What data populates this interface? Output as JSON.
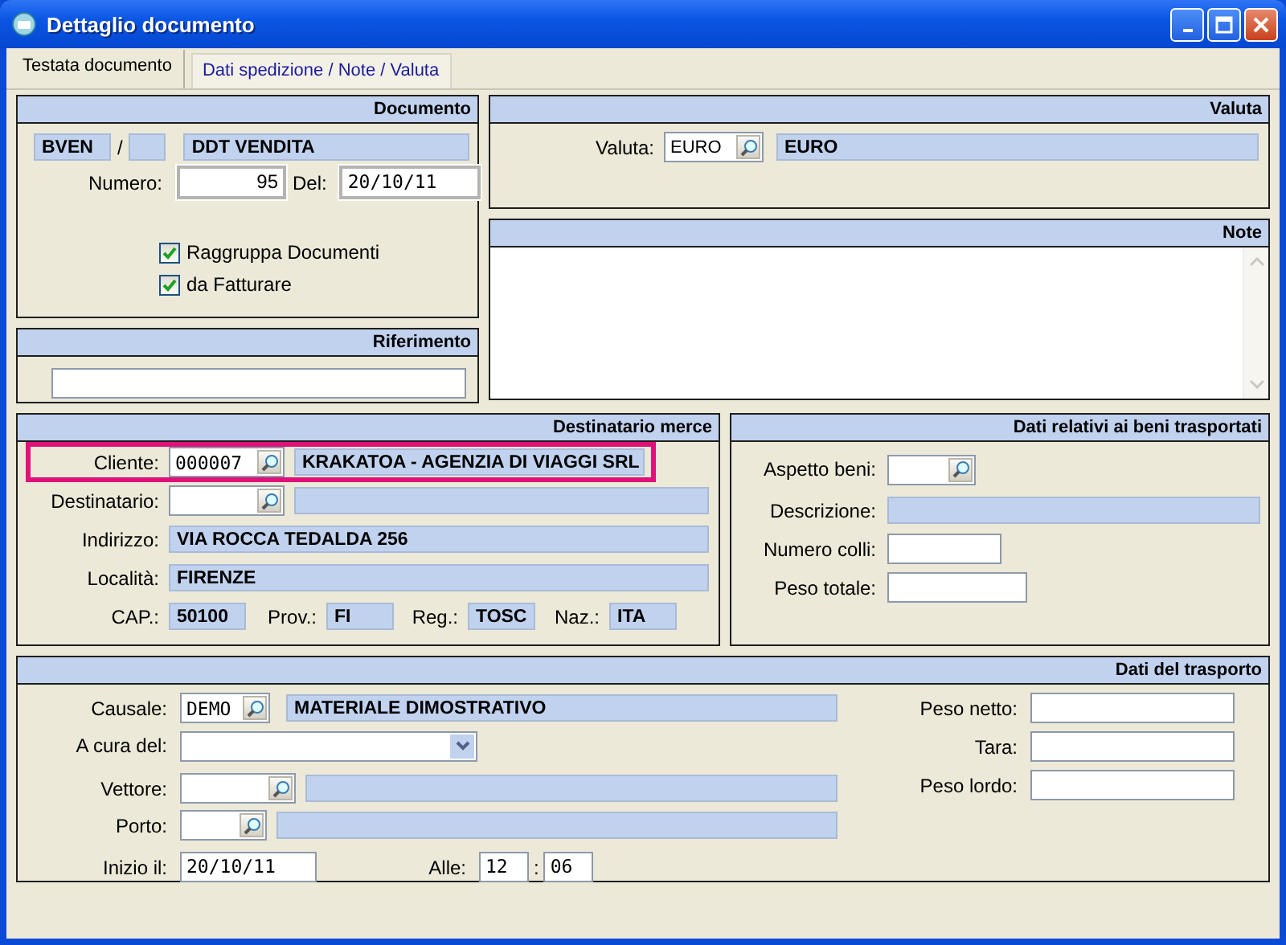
{
  "window": {
    "title": "Dettaglio documento"
  },
  "tabs": [
    {
      "label": "Testata documento",
      "selected": true
    },
    {
      "label": "Dati spedizione / Note / Valuta",
      "selected": false
    }
  ],
  "documento": {
    "title": "Documento",
    "serie": "BVEN",
    "separator": "/",
    "tipo": "DDT VENDITA",
    "numero_label": "Numero:",
    "numero": "95",
    "del_label": "Del:",
    "data": "20/10/11",
    "checkboxes": [
      {
        "label": "Raggruppa Documenti",
        "checked": true
      },
      {
        "label": "da Fatturare",
        "checked": true
      }
    ]
  },
  "riferimento": {
    "title": "Riferimento"
  },
  "valuta": {
    "title": "Valuta",
    "label": "Valuta:",
    "code": "EURO",
    "description": "EURO"
  },
  "note": {
    "title": "Note"
  },
  "destinatario": {
    "title": "Destinatario merce",
    "rows": [
      {
        "kind": "lookup",
        "label": "Cliente:",
        "code": "000007",
        "description": "KRAKATOA - AGENZIA DI VIAGGI SRL",
        "highlighted": true
      },
      {
        "kind": "lookup",
        "label": "Destinatario:",
        "highlighted": false
      },
      {
        "kind": "readonly",
        "label": "Indirizzo:",
        "value": "VIA ROCCA TEDALDA 256"
      },
      {
        "kind": "readonly",
        "label": "Località:",
        "value": "FIRENZE"
      },
      {
        "kind": "multi",
        "items": [
          {
            "label": "CAP.:",
            "value": "50100"
          },
          {
            "label": "Prov.:",
            "value": "FI"
          },
          {
            "label": "Reg.:",
            "value": "TOSC"
          },
          {
            "label": "Naz.:",
            "value": "ITA"
          }
        ]
      }
    ]
  },
  "beni": {
    "title": "Dati relativi ai beni trasportati",
    "rows": [
      {
        "kind": "lookup",
        "label": "Aspetto beni:"
      },
      {
        "kind": "readonly",
        "label": "Descrizione:"
      },
      {
        "kind": "short",
        "label": "Numero colli:"
      },
      {
        "kind": "text",
        "label": "Peso totale:"
      }
    ]
  },
  "trasporto": {
    "title": "Dati del trasporto",
    "rows": [
      {
        "kind": "lookup",
        "label": "Causale:",
        "code": "DEMO",
        "description": "MATERIALE DIMOSTRATIVO"
      },
      {
        "kind": "combo",
        "label": "A cura del:"
      },
      {
        "kind": "lookup",
        "label": "Vettore:"
      },
      {
        "kind": "lookup",
        "label": "Porto:"
      },
      {
        "kind": "datetime",
        "label": "Inizio il:",
        "value": "20/10/11",
        "time_label": "Alle:",
        "hour": "12",
        "separator": ":",
        "minute": "06"
      }
    ],
    "weights": [
      {
        "label": "Peso netto:"
      },
      {
        "label": "Tara:"
      },
      {
        "label": "Peso lordo:"
      }
    ]
  }
}
